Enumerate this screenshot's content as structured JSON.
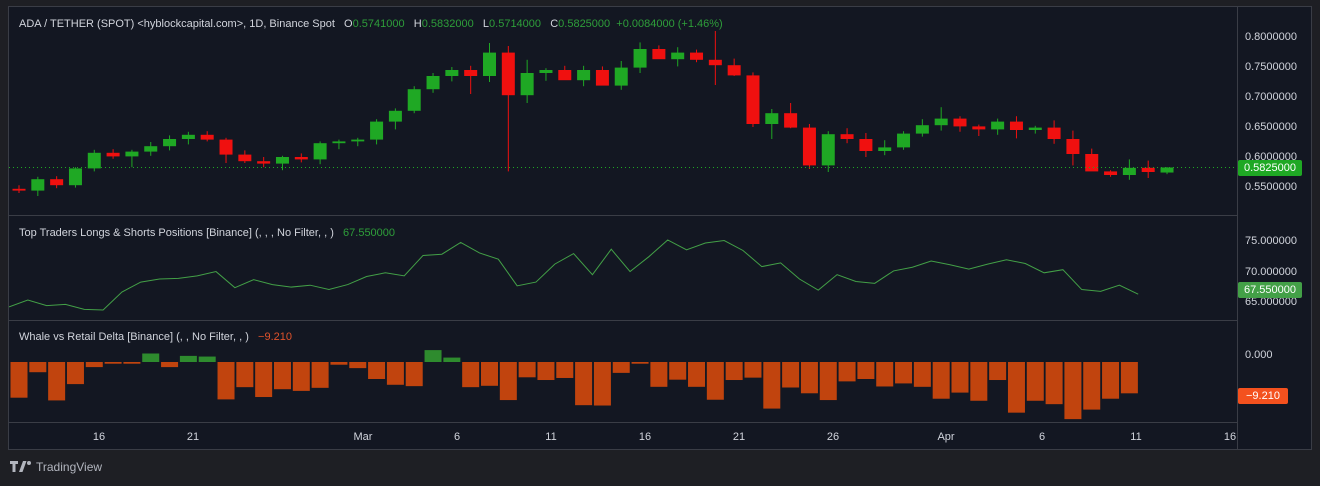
{
  "main_legend": {
    "symbol": "ADA / TETHER (SPOT) <hyblockcapital.com>, 1D, Binance Spot",
    "o_label": "O",
    "o_value": "0.5741000",
    "h_label": "H",
    "h_value": "0.5832000",
    "l_label": "L",
    "l_value": "0.5714000",
    "c_label": "C",
    "c_value": "0.5825000",
    "change": "+0.0084000 (+1.46%)"
  },
  "price_axis": [
    "0.8000000",
    "0.7500000",
    "0.7000000",
    "0.6500000",
    "0.6000000",
    "0.5500000"
  ],
  "price_tag": "0.5825000",
  "indicator1": {
    "title": "Top Traders Longs & Shorts Positions [Binance] (, , , No Filter, , )",
    "value": "67.550000",
    "axis": [
      "75.000000",
      "70.000000",
      "65.000000"
    ],
    "tag": "67.550000"
  },
  "indicator2": {
    "title": "Whale vs Retail Delta [Binance] (, , No Filter, , )",
    "value": "−9.210",
    "axis": [
      "0.000"
    ],
    "tag": "−9.210"
  },
  "time_axis": [
    "16",
    "21",
    "Mar",
    "6",
    "11",
    "16",
    "21",
    "26",
    "Apr",
    "6",
    "11",
    "16"
  ],
  "footer": {
    "brand": "TradingView"
  },
  "colors": {
    "up": "#1fa824",
    "down": "#f0100f",
    "line": "#43a047",
    "hist_pos": "#2e8b2e",
    "hist_neg": "#c1440e"
  },
  "chart_data": {
    "type": "candlestick",
    "candles": [
      [
        0.547,
        0.553,
        0.54,
        0.544
      ],
      [
        0.544,
        0.567,
        0.535,
        0.563
      ],
      [
        0.563,
        0.568,
        0.548,
        0.553
      ],
      [
        0.553,
        0.583,
        0.549,
        0.581
      ],
      [
        0.581,
        0.612,
        0.576,
        0.607
      ],
      [
        0.607,
        0.613,
        0.597,
        0.601
      ],
      [
        0.601,
        0.612,
        0.583,
        0.609
      ],
      [
        0.609,
        0.625,
        0.602,
        0.618
      ],
      [
        0.618,
        0.636,
        0.611,
        0.63
      ],
      [
        0.63,
        0.642,
        0.621,
        0.637
      ],
      [
        0.637,
        0.643,
        0.626,
        0.629
      ],
      [
        0.629,
        0.632,
        0.59,
        0.604
      ],
      [
        0.604,
        0.611,
        0.59,
        0.593
      ],
      [
        0.593,
        0.6,
        0.583,
        0.589
      ],
      [
        0.589,
        0.602,
        0.578,
        0.6
      ],
      [
        0.6,
        0.606,
        0.591,
        0.596
      ],
      [
        0.596,
        0.626,
        0.588,
        0.623
      ],
      [
        0.623,
        0.629,
        0.613,
        0.626
      ],
      [
        0.626,
        0.632,
        0.618,
        0.629
      ],
      [
        0.629,
        0.663,
        0.621,
        0.659
      ],
      [
        0.659,
        0.681,
        0.646,
        0.677
      ],
      [
        0.677,
        0.718,
        0.673,
        0.713
      ],
      [
        0.713,
        0.74,
        0.707,
        0.735
      ],
      [
        0.735,
        0.75,
        0.726,
        0.745
      ],
      [
        0.745,
        0.752,
        0.705,
        0.735
      ],
      [
        0.735,
        0.79,
        0.725,
        0.774
      ],
      [
        0.774,
        0.785,
        0.576,
        0.703
      ],
      [
        0.703,
        0.762,
        0.69,
        0.74
      ],
      [
        0.74,
        0.748,
        0.727,
        0.745
      ],
      [
        0.745,
        0.752,
        0.735,
        0.728
      ],
      [
        0.728,
        0.752,
        0.718,
        0.745
      ],
      [
        0.745,
        0.751,
        0.725,
        0.719
      ],
      [
        0.719,
        0.76,
        0.712,
        0.749
      ],
      [
        0.749,
        0.791,
        0.74,
        0.78
      ],
      [
        0.78,
        0.786,
        0.765,
        0.763
      ],
      [
        0.763,
        0.783,
        0.751,
        0.774
      ],
      [
        0.774,
        0.779,
        0.758,
        0.762
      ],
      [
        0.762,
        0.81,
        0.72,
        0.753
      ],
      [
        0.753,
        0.764,
        0.735,
        0.736
      ],
      [
        0.736,
        0.741,
        0.65,
        0.655
      ],
      [
        0.655,
        0.68,
        0.63,
        0.673
      ],
      [
        0.673,
        0.69,
        0.648,
        0.649
      ],
      [
        0.649,
        0.655,
        0.58,
        0.586
      ],
      [
        0.586,
        0.643,
        0.575,
        0.638
      ],
      [
        0.638,
        0.648,
        0.623,
        0.63
      ],
      [
        0.63,
        0.64,
        0.6,
        0.61
      ],
      [
        0.61,
        0.628,
        0.603,
        0.616
      ],
      [
        0.616,
        0.643,
        0.612,
        0.639
      ],
      [
        0.639,
        0.663,
        0.634,
        0.653
      ],
      [
        0.653,
        0.683,
        0.644,
        0.664
      ],
      [
        0.664,
        0.668,
        0.642,
        0.651
      ],
      [
        0.651,
        0.654,
        0.635,
        0.646
      ],
      [
        0.646,
        0.664,
        0.637,
        0.659
      ],
      [
        0.659,
        0.668,
        0.631,
        0.645
      ],
      [
        0.645,
        0.652,
        0.639,
        0.649
      ],
      [
        0.649,
        0.661,
        0.622,
        0.63
      ],
      [
        0.63,
        0.644,
        0.586,
        0.605
      ],
      [
        0.605,
        0.614,
        0.58,
        0.576
      ],
      [
        0.576,
        0.578,
        0.567,
        0.57
      ],
      [
        0.57,
        0.596,
        0.562,
        0.582
      ],
      [
        0.582,
        0.594,
        0.565,
        0.575
      ],
      [
        0.5741,
        0.5832,
        0.5714,
        0.5825
      ]
    ],
    "ylim": [
      0.53,
      0.81
    ],
    "longs_shorts": [
      65.5,
      66.6,
      65.7,
      65.9,
      65.1,
      65.0,
      67.9,
      69.5,
      70.0,
      70.1,
      70.5,
      71.2,
      68.6,
      69.9,
      69.1,
      68.7,
      69.0,
      68.3,
      69.1,
      70.4,
      71.0,
      70.5,
      73.8,
      74.0,
      75.9,
      74.2,
      73.2,
      68.9,
      69.5,
      72.4,
      74.1,
      70.7,
      74.8,
      71.2,
      73.6,
      76.3,
      74.7,
      75.8,
      76.2,
      74.6,
      72.0,
      72.6,
      70.0,
      68.2,
      70.7,
      69.6,
      69.3,
      71.3,
      71.9,
      72.9,
      72.3,
      71.6,
      72.4,
      73.1,
      72.5,
      71.0,
      71.5,
      68.3,
      68.0,
      69.0,
      67.55
    ],
    "longs_shorts_ylim": [
      63.5,
      77.5
    ],
    "whale_delta": [
      -10.5,
      -3.0,
      -11.3,
      -6.5,
      -1.5,
      -0.5,
      -0.5,
      2.5,
      -1.5,
      1.8,
      1.6,
      -11.0,
      -7.4,
      -10.3,
      -8.0,
      -8.5,
      -7.6,
      -0.8,
      -1.8,
      -5.0,
      -6.7,
      -7.1,
      3.5,
      1.3,
      -7.4,
      -7.0,
      -11.2,
      -4.5,
      -5.3,
      -4.7,
      -12.7,
      -12.8,
      -3.2,
      -0.5,
      -7.3,
      -5.2,
      -7.3,
      -11.1,
      -5.3,
      -4.6,
      -13.7,
      -7.5,
      -9.2,
      -11.2,
      -5.7,
      -5.0,
      -7.2,
      -6.3,
      -7.3,
      -10.8,
      -9.0,
      -11.4,
      -5.3,
      -14.9,
      -11.4,
      -12.4,
      -16.8,
      -14.0,
      -10.8,
      -9.21
    ],
    "whale_delta_ylim": [
      -17.5,
      7
    ]
  }
}
